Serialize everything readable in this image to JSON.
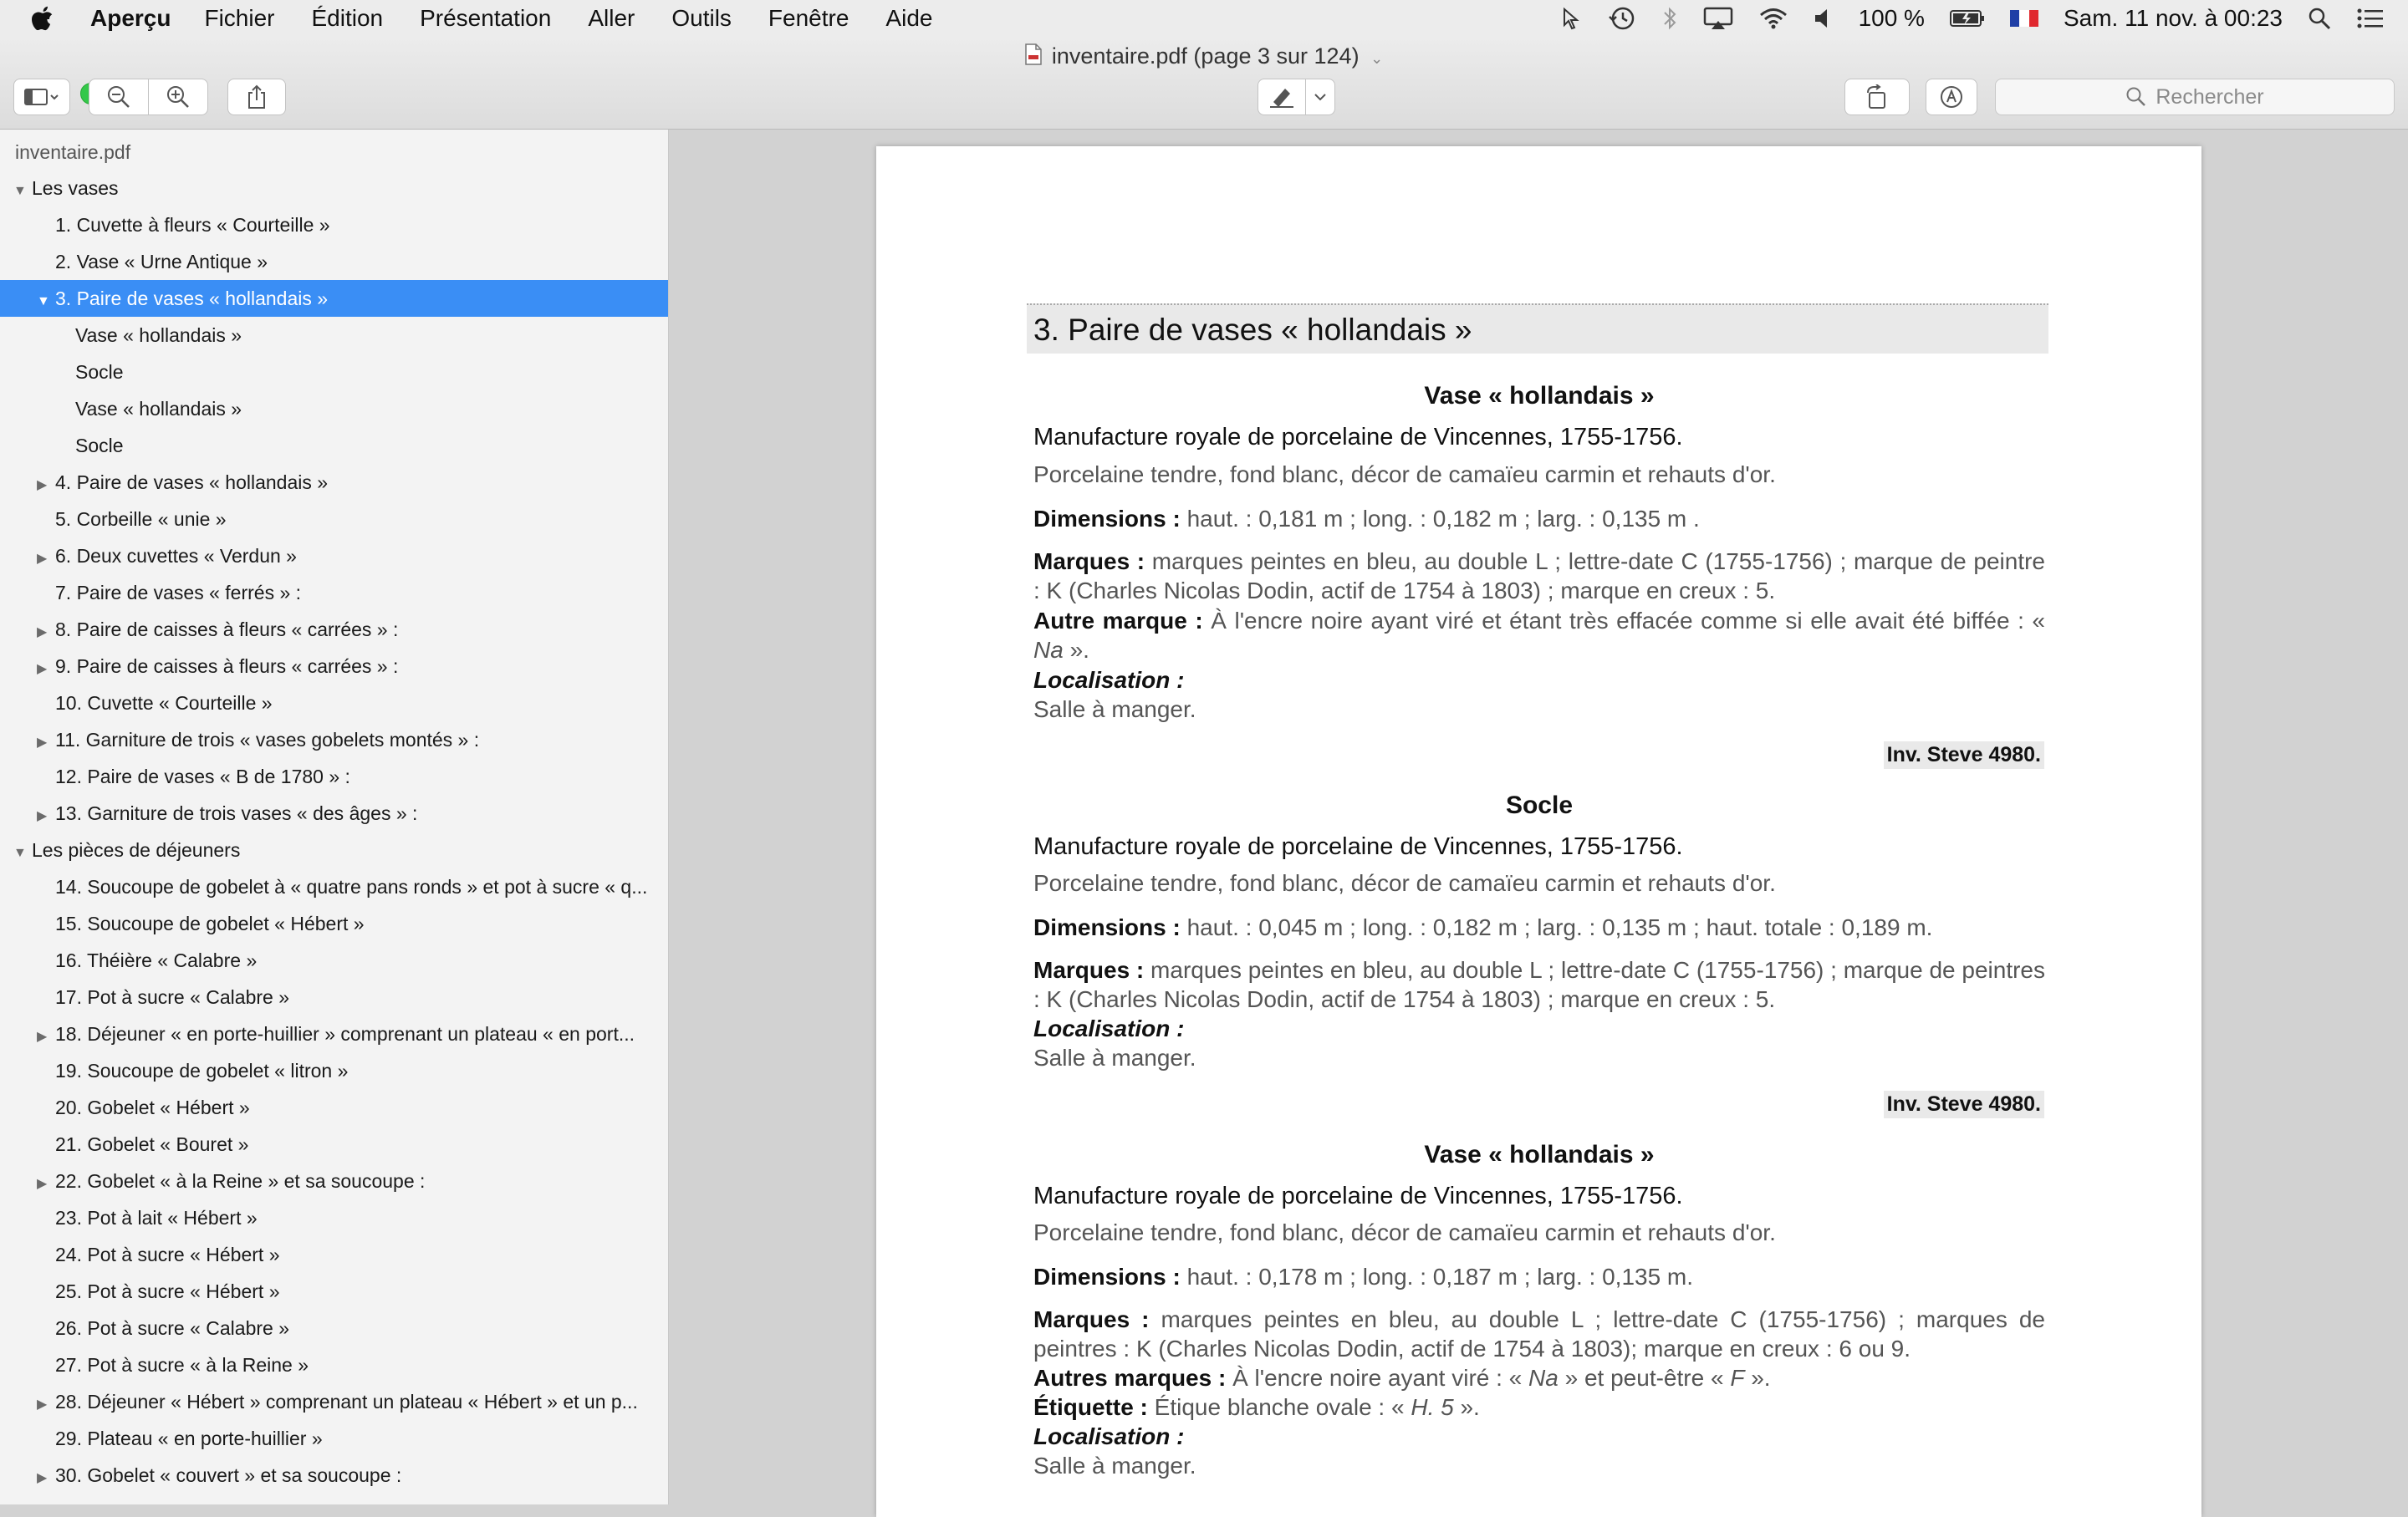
{
  "menubar": {
    "app": "Aperçu",
    "items": [
      "Fichier",
      "Édition",
      "Présentation",
      "Aller",
      "Outils",
      "Fenêtre",
      "Aide"
    ],
    "battery": "100 %",
    "clock": "Sam. 11 nov. à 00:23"
  },
  "window": {
    "title": "inventaire.pdf (page 3 sur 124)",
    "search_placeholder": "Rechercher"
  },
  "sidebar": {
    "file": "inventaire.pdf",
    "rows": [
      {
        "text": "Les vases",
        "indent": 0,
        "tri": "down"
      },
      {
        "text": "1. Cuvette à fleurs « Courteille »",
        "indent": 1,
        "tri": ""
      },
      {
        "text": "2. Vase « Urne Antique »",
        "indent": 1,
        "tri": ""
      },
      {
        "text": "3. Paire de vases « hollandais »",
        "indent": 1,
        "tri": "down",
        "selected": true
      },
      {
        "text": "Vase « hollandais »",
        "indent": 2,
        "tri": ""
      },
      {
        "text": "Socle",
        "indent": 2,
        "tri": ""
      },
      {
        "text": "Vase « hollandais »",
        "indent": 2,
        "tri": ""
      },
      {
        "text": "Socle",
        "indent": 2,
        "tri": ""
      },
      {
        "text": "4. Paire de vases « hollandais »",
        "indent": 1,
        "tri": "right"
      },
      {
        "text": "5. Corbeille « unie »",
        "indent": 1,
        "tri": ""
      },
      {
        "text": "6. Deux cuvettes « Verdun »",
        "indent": 1,
        "tri": "right"
      },
      {
        "text": "7. Paire de vases « ferrés » :",
        "indent": 1,
        "tri": ""
      },
      {
        "text": "8. Paire de caisses à fleurs « carrées » :",
        "indent": 1,
        "tri": "right"
      },
      {
        "text": "9. Paire de caisses à fleurs « carrées » :",
        "indent": 1,
        "tri": "right"
      },
      {
        "text": "10. Cuvette « Courteille »",
        "indent": 1,
        "tri": ""
      },
      {
        "text": "11. Garniture de trois « vases gobelets montés » :",
        "indent": 1,
        "tri": "right"
      },
      {
        "text": "12. Paire de vases « B de 1780 » :",
        "indent": 1,
        "tri": ""
      },
      {
        "text": "13. Garniture de trois vases « des âges » :",
        "indent": 1,
        "tri": "right"
      },
      {
        "text": "Les pièces de déjeuners",
        "indent": 0,
        "tri": "down"
      },
      {
        "text": "14. Soucoupe de gobelet à « quatre pans ronds » et pot à sucre « q...",
        "indent": 1,
        "tri": ""
      },
      {
        "text": "15. Soucoupe de gobelet « Hébert »",
        "indent": 1,
        "tri": ""
      },
      {
        "text": "16. Théière « Calabre »",
        "indent": 1,
        "tri": ""
      },
      {
        "text": "17. Pot à sucre « Calabre »",
        "indent": 1,
        "tri": ""
      },
      {
        "text": "18. Déjeuner « en porte-huillier » comprenant un plateau « en port...",
        "indent": 1,
        "tri": "right"
      },
      {
        "text": "19. Soucoupe de gobelet « litron »",
        "indent": 1,
        "tri": ""
      },
      {
        "text": "20. Gobelet « Hébert »",
        "indent": 1,
        "tri": ""
      },
      {
        "text": "21. Gobelet « Bouret »",
        "indent": 1,
        "tri": ""
      },
      {
        "text": "22. Gobelet  « à la Reine » et sa soucoupe :",
        "indent": 1,
        "tri": "right"
      },
      {
        "text": "23. Pot à lait « Hébert »",
        "indent": 1,
        "tri": ""
      },
      {
        "text": "24. Pot à sucre « Hébert »",
        "indent": 1,
        "tri": ""
      },
      {
        "text": "25. Pot à sucre « Hébert »",
        "indent": 1,
        "tri": ""
      },
      {
        "text": "26. Pot à sucre « Calabre »",
        "indent": 1,
        "tri": ""
      },
      {
        "text": "27. Pot à sucre « à la Reine »",
        "indent": 1,
        "tri": ""
      },
      {
        "text": "28. Déjeuner « Hébert » comprenant un plateau « Hébert » et un p...",
        "indent": 1,
        "tri": "right"
      },
      {
        "text": "29. Plateau « en porte-huillier »",
        "indent": 1,
        "tri": ""
      },
      {
        "text": "30. Gobelet « couvert » et sa soucoupe :",
        "indent": 1,
        "tri": "right"
      }
    ]
  },
  "document": {
    "section_title": "3. Paire de vases « hollandais »",
    "b1": {
      "heading": "Vase « hollandais »",
      "manufacture": "Manufacture royale de porcelaine de Vincennes, 1755-1756.",
      "desc": "Porcelaine tendre, fond blanc, décor de camaïeu carmin et rehauts d'or.",
      "dim_label": "Dimensions :",
      "dim_text": " haut. : 0,181 m ; long. : 0,182 m ; larg. : 0,135 m .",
      "marques_label": "Marques :",
      "marques_text": " marques peintes en bleu, au double L ; lettre-date C (1755-1756) ; marque de peintre : K  (Charles Nicolas Dodin, actif de 1754 à 1803) ; marque en creux : 5.",
      "autre_label": "Autre marque :",
      "autre_text_1": " À l'encre noire ayant viré et étant très effacée comme si elle avait été biffée : « ",
      "autre_em": "Na",
      "autre_text_2": " ».",
      "loc_label": "Localisation :",
      "loc_text": "Salle à manger.",
      "inv": "Inv. Steve 4980."
    },
    "b2": {
      "heading": "Socle",
      "manufacture": "Manufacture royale de porcelaine de Vincennes, 1755-1756.",
      "desc": "Porcelaine tendre, fond blanc, décor de camaïeu carmin et rehauts d'or.",
      "dim_label": "Dimensions :",
      "dim_text": " haut. : 0,045 m ; long. : 0,182 m ; larg. : 0,135 m ; haut. totale : 0,189 m.",
      "marques_label": "Marques :",
      "marques_text": " marques peintes en bleu, au double L ; lettre-date C (1755-1756) ; marque de peintres : K (Charles Nicolas Dodin, actif de 1754 à 1803) ; marque en creux : 5.",
      "loc_label": "Localisation :",
      "loc_text": "Salle à manger.",
      "inv": "Inv. Steve 4980."
    },
    "b3": {
      "heading": "Vase « hollandais »",
      "manufacture": "Manufacture royale de porcelaine de Vincennes, 1755-1756.",
      "desc": "Porcelaine tendre, fond blanc, décor de camaïeu carmin et rehauts d'or.",
      "dim_label": "Dimensions :",
      "dim_text": " haut. : 0,178 m ; long. : 0,187 m ; larg. : 0,135 m.",
      "marques_label": "Marques :",
      "marques_text": " marques peintes en bleu, au double L ; lettre-date C (1755-1756) ; marques de peintres : K (Charles Nicolas Dodin, actif de 1754 à 1803); marque en creux : 6 ou 9.",
      "autres_label": "Autres marques :",
      "autres_text_1": " À l'encre noire ayant viré : « ",
      "autres_em_1": "Na",
      "autres_text_2": " » et peut-être « ",
      "autres_em_2": "F",
      "autres_text_3": " ».",
      "etiq_label": "Étiquette :",
      "etiq_text_1": " Étique blanche ovale : « ",
      "etiq_em": "H. 5",
      "etiq_text_2": " ».",
      "loc_label": "Localisation :",
      "loc_text": "Salle à manger."
    }
  },
  "colors": {
    "selection": "#3a8ef5",
    "close": "#fc605c",
    "minimize": "#fdbc40",
    "zoom": "#34c84a"
  }
}
